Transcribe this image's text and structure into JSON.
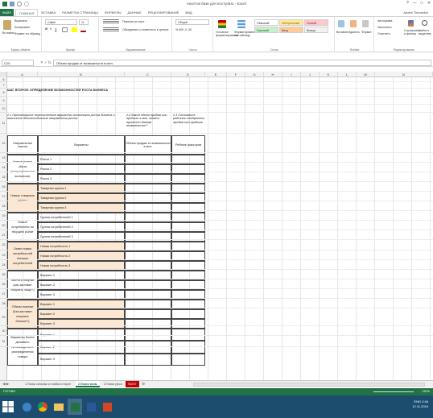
{
  "window": {
    "title": "excel на базе для поступать - Excel",
    "controls": [
      "?",
      "—",
      "□",
      "✕"
    ]
  },
  "ribbon_tabs": {
    "file": "ФАЙЛ",
    "tabs": [
      "ГЛАВНАЯ",
      "ВСТАВКА",
      "РАЗМЕТКА СТРАНИЦЫ",
      "ФОРМУЛЫ",
      "ДАННЫЕ",
      "РЕЦЕНЗИРОВАНИЕ",
      "ВИД"
    ],
    "active": "ГЛАВНАЯ",
    "user": "Andrei Timoshkin"
  },
  "ribbon": {
    "clipboard": {
      "paste": "Вставить",
      "cut": "Вырезать",
      "copy": "Копировать",
      "format_painter": "Формат по образцу",
      "label": "Буфер обмена"
    },
    "font": {
      "name": "Calibri",
      "size": "11",
      "label": "Шрифт"
    },
    "alignment": {
      "wrap": "Перенести текст",
      "merge": "Объединить и поместить в центре",
      "label": "Выравнивание"
    },
    "number": {
      "format": "Общий",
      "label": "Число"
    },
    "styles": {
      "conditional": "Условное форматирование",
      "as_table": "Форматировать как таблицу",
      "cells": [
        "Обычный",
        "Нейтральный",
        "Плохой",
        "Хороший",
        "Ввод",
        "Вывод"
      ],
      "label": "Стили"
    },
    "cells": {
      "insert": "Вставить",
      "delete": "Удалить",
      "format": "Формат",
      "label": "Ячейки"
    },
    "editing": {
      "autosum": "Автосумма",
      "fill": "Заполнить",
      "clear": "Очистить",
      "sort": "Сортировка и фильтр",
      "find": "Найти и выделить",
      "label": "Редактирование"
    }
  },
  "formula_bar": {
    "name_box": "C10",
    "fx": "✕ ✓ fx",
    "formula": "Объем продаж от возможности в млн."
  },
  "columns": [
    "A",
    "B",
    "C",
    "D",
    "E",
    "F",
    "G",
    "H",
    "I",
    "J",
    "K",
    "L",
    "M",
    "N"
  ],
  "rows": [
    "6",
    "7",
    "8",
    "9",
    "10",
    "11",
    "12",
    "13",
    "14",
    "15",
    "16",
    "17",
    "18",
    "19",
    "20",
    "21",
    "22",
    "23",
    "24",
    "25",
    "26",
    "27",
    "28",
    "29",
    "30",
    "31"
  ],
  "sheet": {
    "section_title": "ШАГ ВТОРОЙ: ОПРЕДЕЛЕНИЕ ВОЗМОЖНОСТЕЙ РОСТА БИЗНЕСА",
    "notes": {
      "a": "2.1 Просмотрите перечисленные варианты источников роста бизнеса и напишите дополнительные направления роста.",
      "c": "2.2 Какой объем продаж или прибыль в млн. может принести данная возможность?",
      "d": "2.3 Составьте рейтинг отобранных продаж или прибыли"
    },
    "headers": {
      "direction": "Направление поиска",
      "variants": "Варианты",
      "volume": "Объем продаж от возможности в млн.",
      "rating": "Рейтинг факторов"
    },
    "groups": [
      {
        "label": "Новые рынки сбыта (географическое экспансия)",
        "items": [
          "Рынок 1",
          "Рынок 2",
          "Рынок 3"
        ],
        "beige": false
      },
      {
        "label": "Новые товарные группы",
        "items": [
          "Товарная группа 1",
          "Товарная группа 2",
          "Товарная группа 3"
        ],
        "beige": true
      },
      {
        "label": "Новые потребители на текущем рынке",
        "items": [
          "Группа потребителей 1",
          "Группа потребителей 2",
          "Группа потребителей 3"
        ],
        "beige": false
      },
      {
        "label": "Охват новых потребностей текущих потребителей",
        "items": [
          "Новая потребность 1",
          "Новая потребность 2",
          "Новая потребность 3"
        ],
        "beige": true
      },
      {
        "label": "Частота покупки (как заставит покупать чаще?)",
        "items": [
          "Вариант 1",
          "Вариант 2",
          "Вариант 3"
        ],
        "beige": false
      },
      {
        "label": "Объем покупки (Как заставит покупать больше?)",
        "items": [
          "Вариант 1",
          "Вариант 2",
          "Вариант 3"
        ],
        "beige": true
      },
      {
        "label": "Варианты более дешевого производства и распределения товара",
        "items": [
          "Вариант 1",
          "Вариант 2",
          "Вариант 3"
        ],
        "beige": false
      }
    ]
  },
  "sheet_tabs": {
    "tabs": [
      "1.Поиск сильных и слабых сторон",
      "2.Поиск возм.",
      "3.Поиск угроз",
      "SWOT"
    ],
    "active": "2.Поиск возм.",
    "add": "⊕"
  },
  "status": {
    "ready": "ГОТОВО",
    "zoom": "130%"
  },
  "taskbar": {
    "apps": [
      "explorer",
      "chrome",
      "folder",
      "excel",
      "word",
      "powerpoint"
    ],
    "time": "2:46",
    "date": "12.11.2016",
    "lang": "ENG"
  },
  "colors": {
    "excel_green": "#217346",
    "beige": "#fbe7d2",
    "title_blue": "#1f3864",
    "note_blue": "#2f5597",
    "swot_red": "#c00000",
    "taskbar": "#1c4d6e"
  }
}
